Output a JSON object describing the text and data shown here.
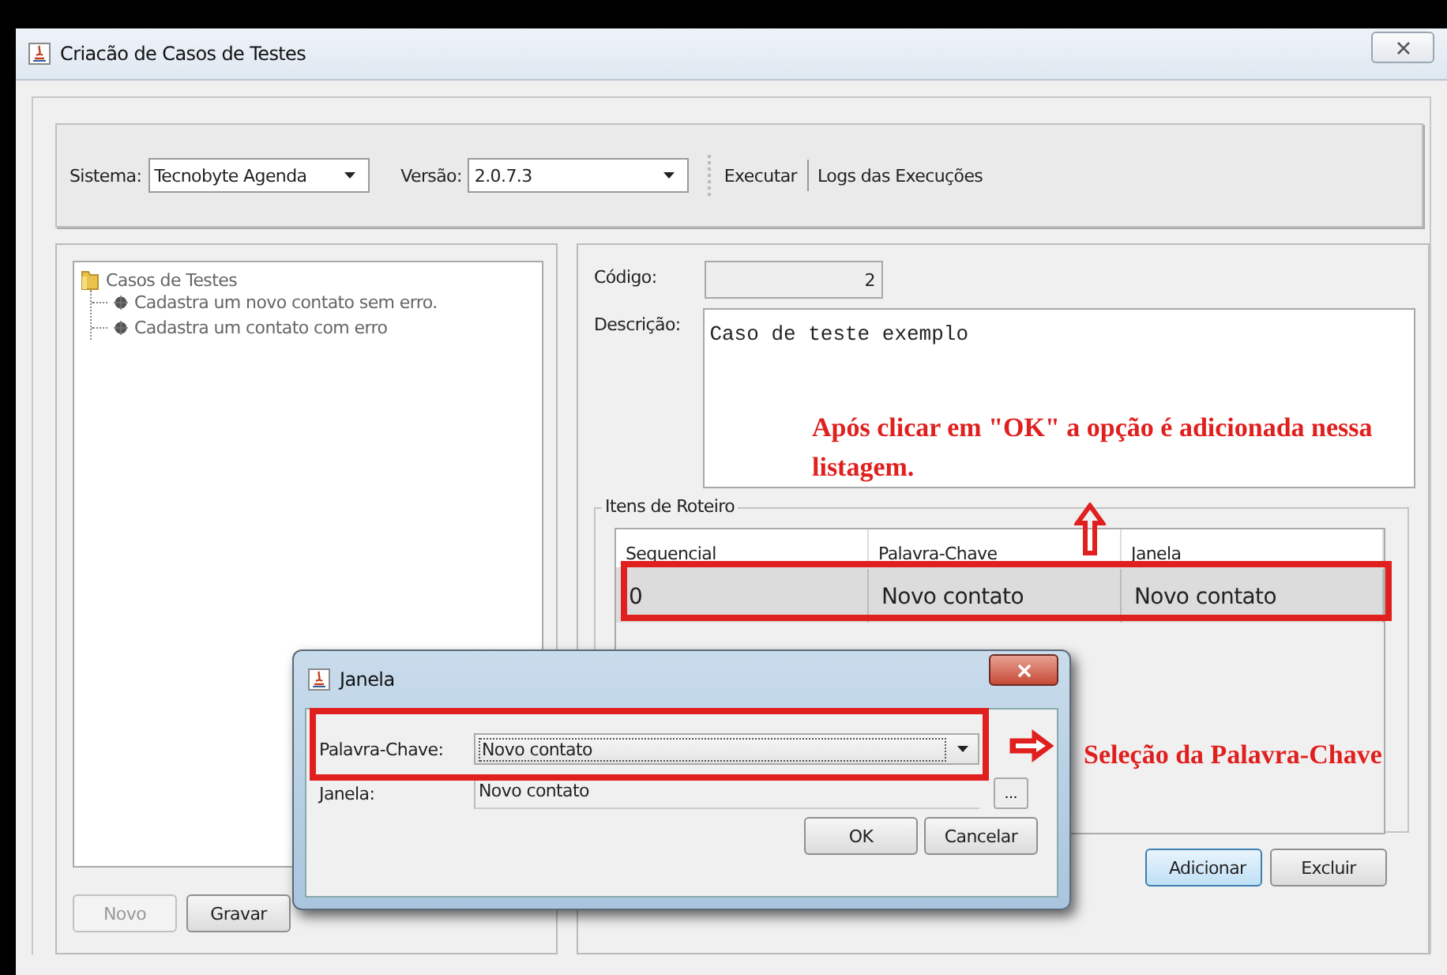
{
  "window": {
    "title": "Criacão de Casos de Testes"
  },
  "toolbar": {
    "fields": [
      {
        "label": "Sistema:",
        "value": "Tecnobyte Agenda"
      },
      {
        "label": "Versão:",
        "value": "2.0.7.3"
      }
    ],
    "links": [
      "Executar",
      "Logs das Execuções"
    ]
  },
  "tree": {
    "label": "Casos de Testes",
    "children": [
      {
        "label": "Cadastra um novo contato sem erro."
      },
      {
        "label": "Cadastra um contato com erro"
      }
    ]
  },
  "left_buttons": [
    {
      "label": "Novo",
      "disabled": true
    },
    {
      "label": "Gravar",
      "disabled": false
    }
  ],
  "form": {
    "code_label": "Código:",
    "code_value": "2",
    "description_label": "Descrição:",
    "description_value": "Caso de teste exemplo"
  },
  "roteiro": {
    "title": "Itens de Roteiro",
    "columns": [
      "Sequencial",
      "Palavra-Chave",
      "Janela"
    ],
    "rows": [
      {
        "cells": [
          "0",
          "Novo contato",
          "Novo contato"
        ],
        "selected": true
      }
    ]
  },
  "right_buttons": [
    {
      "label": "Adicionar",
      "focused": true
    },
    {
      "label": "Excluir",
      "focused": false
    }
  ],
  "dialog": {
    "title": "Janela",
    "fields": [
      {
        "kind": "combo",
        "label": "Palavra-Chave:",
        "value": "Novo contato"
      },
      {
        "kind": "browse",
        "label": "Janela:",
        "value": "Novo contato",
        "button": "..."
      }
    ],
    "buttons": [
      "OK",
      "Cancelar"
    ]
  },
  "annotations": [
    "Após clicar em \"OK\" a opção é adicionada nessa listagem.",
    "Seleção da Palavra-Chave"
  ]
}
